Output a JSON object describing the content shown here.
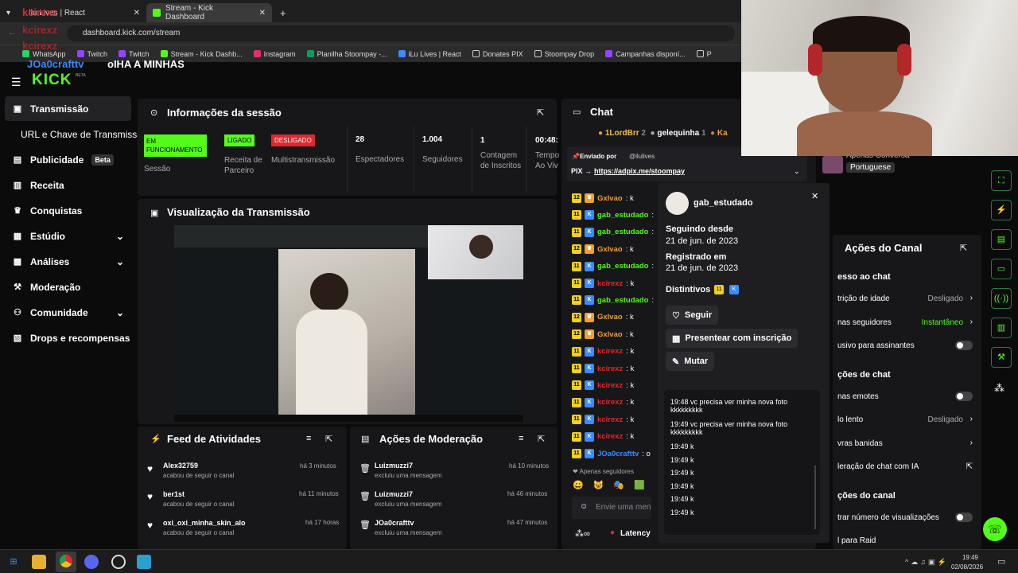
{
  "browser": {
    "tabs": [
      {
        "label": "Ilu Lives | React"
      },
      {
        "label": "Stream - Kick Dashboard"
      }
    ],
    "new_tab": "+",
    "url": "dashboard.kick.com/stream",
    "bookmarks": [
      "WhatsApp",
      "Twitch",
      "Twitch",
      "Stream - Kick Dashb...",
      "Instagram",
      "Planilha Stoompay -...",
      "iLu Lives | React",
      "Donates PIX",
      "Stoompay Drop",
      "Campanhas disponí...",
      "P"
    ]
  },
  "overlay": {
    "names": [
      "kcirexz",
      "kcirexz",
      "kcirexz"
    ],
    "line": "JOa0crafttv",
    "message": "oIHA A MINHAS"
  },
  "logo": {
    "text": "KICK",
    "beta": "BETA"
  },
  "sidebar": {
    "items": [
      {
        "label": "Transmissão",
        "icon": "broadcast-icon"
      },
      {
        "label": "URL e Chave de Transmissão",
        "icon": ""
      },
      {
        "label": "Publicidade",
        "badge": "Beta",
        "icon": "ads-icon"
      },
      {
        "label": "Receita",
        "icon": "revenue-icon"
      },
      {
        "label": "Conquistas",
        "icon": "trophy-icon"
      },
      {
        "label": "Estúdio",
        "icon": "studio-icon"
      },
      {
        "label": "Análises",
        "icon": "analytics-icon"
      },
      {
        "label": "Moderação",
        "icon": "moderation-icon"
      },
      {
        "label": "Comunidade",
        "icon": "community-icon"
      },
      {
        "label": "Drops e recompensas",
        "icon": "drops-icon"
      }
    ]
  },
  "session": {
    "title": "Informações da sessão",
    "status": [
      {
        "badge": "EM FUNCIONAMENTO",
        "label": "Sessão",
        "color": "#53fc18"
      },
      {
        "badge": "LIGADO",
        "label": "Receita de Parceiro",
        "color": "#53fc18"
      },
      {
        "badge": "DESLIGADO",
        "label": "Multistransmissão",
        "color": "#e0282e"
      }
    ],
    "stats": [
      {
        "value": "28",
        "label": "Espectadores"
      },
      {
        "value": "1.004",
        "label": "Seguidores"
      },
      {
        "value": "1",
        "label": "Contagem de Inscritos"
      },
      {
        "value": "00:48:",
        "label": "Tempo Ao Viv"
      }
    ]
  },
  "preview": {
    "title": "Visualização da Transmissão"
  },
  "activity": {
    "title": "Feed de Atividades",
    "items": [
      {
        "user": "Alex32759",
        "action": "acabou de seguir o canal",
        "time": "há 3 minutos"
      },
      {
        "user": "ber1st",
        "action": "acabou de seguir o canal",
        "time": "há 11 minutos"
      },
      {
        "user": "oxi_oxi_minha_skin_alo",
        "action": "acabou de seguir o canal",
        "time": "há 17 horas"
      }
    ]
  },
  "modactions": {
    "title": "Ações de Moderação",
    "items": [
      {
        "user": "Luizmuzzi7",
        "action": "excluiu uma mensagem",
        "time": "há 10 minutos"
      },
      {
        "user": "Luizmuzzi7",
        "action": "excluiu uma mensagem",
        "time": "há 46 minutos"
      },
      {
        "user": "JOa0crafttv",
        "action": "excluiu uma mensagem",
        "time": "há 47 minutos"
      }
    ]
  },
  "chat": {
    "title": "Chat",
    "top": [
      {
        "name": "1LordBrr",
        "count": "2"
      },
      {
        "name": "gelequinha",
        "count": "1"
      },
      {
        "name": "Ka",
        "count": ""
      }
    ],
    "pinned_by": "Enviado por",
    "pinned_user": "@ilulives",
    "pinned_msg_prefix": "PIX →",
    "pinned_link": "https://adpix.me/stoompay",
    "lines": [
      {
        "badge": "12",
        "name": "Gxlvao",
        "msg": ": k",
        "color": "#f0a030"
      },
      {
        "badge": "11",
        "name": "gab_estudado",
        "msg": ":",
        "color": "#53fc18"
      },
      {
        "badge": "11",
        "name": "gab_estudado",
        "msg": ":",
        "color": "#53fc18"
      },
      {
        "badge": "12",
        "name": "Gxlvao",
        "msg": ": k",
        "color": "#f0a030"
      },
      {
        "badge": "11",
        "name": "gab_estudado",
        "msg": ":",
        "color": "#53fc18"
      },
      {
        "badge": "11",
        "name": "kcirexz",
        "msg": ": k",
        "color": "#e0282e"
      },
      {
        "badge": "11",
        "name": "gab_estudado",
        "msg": ":",
        "color": "#53fc18"
      },
      {
        "badge": "12",
        "name": "Gxlvao",
        "msg": ": k",
        "color": "#f0a030"
      },
      {
        "badge": "12",
        "name": "Gxlvao",
        "msg": ": k",
        "color": "#f0a030"
      },
      {
        "badge": "11",
        "name": "kcirexz",
        "msg": ": k",
        "color": "#e0282e"
      },
      {
        "badge": "11",
        "name": "kcirexz",
        "msg": ": k",
        "color": "#e0282e"
      },
      {
        "badge": "11",
        "name": "kcirexz",
        "msg": ": k",
        "color": "#e0282e"
      },
      {
        "badge": "11",
        "name": "kcirexz",
        "msg": ": k",
        "color": "#e0282e"
      },
      {
        "badge": "11",
        "name": "kcirexz",
        "msg": ": k",
        "color": "#e0282e"
      },
      {
        "badge": "11",
        "name": "kcirexz",
        "msg": ": k",
        "color": "#e0282e"
      },
      {
        "badge": "11",
        "name": "JOa0crafttv",
        "msg": ": o",
        "color": "#3a8cff"
      }
    ],
    "followers_only": "Apenas seguidores",
    "input_placeholder": "Envie uma men",
    "latency": "Latency"
  },
  "user_popup": {
    "username": "gab_estudado",
    "following_label": "Seguindo desde",
    "following_date": "21 de jun. de 2023",
    "registered_label": "Registrado em",
    "registered_date": "21 de jun. de 2023",
    "badges_label": "Distintivos",
    "badge_num": "11",
    "follow": "Seguir",
    "gift": "Presentear com inscrição",
    "mute": "Mutar",
    "messages": [
      {
        "time": "19:48",
        "text": "vc precisa ver minha nova foto kkkkkkkkk"
      },
      {
        "time": "19:49",
        "text": "vc precisa ver minha nova foto kkkkkkkkk"
      },
      {
        "time": "19:49",
        "text": "k"
      },
      {
        "time": "19:49",
        "text": "k"
      },
      {
        "time": "19:49",
        "text": "k"
      },
      {
        "time": "19:49",
        "text": "k"
      },
      {
        "time": "19:49",
        "text": "k"
      },
      {
        "time": "19:49",
        "text": "k"
      }
    ]
  },
  "stream_info": {
    "category_label": "Apenas Conversa",
    "language": "Portuguese"
  },
  "channel_actions": {
    "title": "Ações do Canal",
    "sections": [
      {
        "title": "esso ao chat",
        "rows": [
          {
            "label": "trição de idade",
            "value": "Desligado",
            "type": "chevron"
          },
          {
            "label": "nas seguidores",
            "value": "Instantâneo",
            "type": "chevron",
            "green": true
          },
          {
            "label": "usivo para assinantes",
            "value": "",
            "type": "toggle"
          }
        ]
      },
      {
        "title": "ções de chat",
        "rows": [
          {
            "label": "nas emotes",
            "value": "",
            "type": "toggle"
          },
          {
            "label": "lo lento",
            "value": "Desligado",
            "type": "chevron"
          },
          {
            "label": "vras banidas",
            "value": "",
            "type": "chevron"
          },
          {
            "label": "leração de chat com IA",
            "value": "",
            "type": "external"
          }
        ]
      },
      {
        "title": "ções do canal",
        "rows": [
          {
            "label": "trar número de visualizações",
            "value": "",
            "type": "toggle"
          },
          {
            "label": "l para Raid",
            "value": "",
            "type": "none"
          }
        ]
      }
    ]
  },
  "taskbar": {
    "time": "19:49",
    "date": "02/08/2026"
  },
  "colors": {
    "kick_green": "#53fc18",
    "red": "#e0282e",
    "panel": "#171719"
  }
}
